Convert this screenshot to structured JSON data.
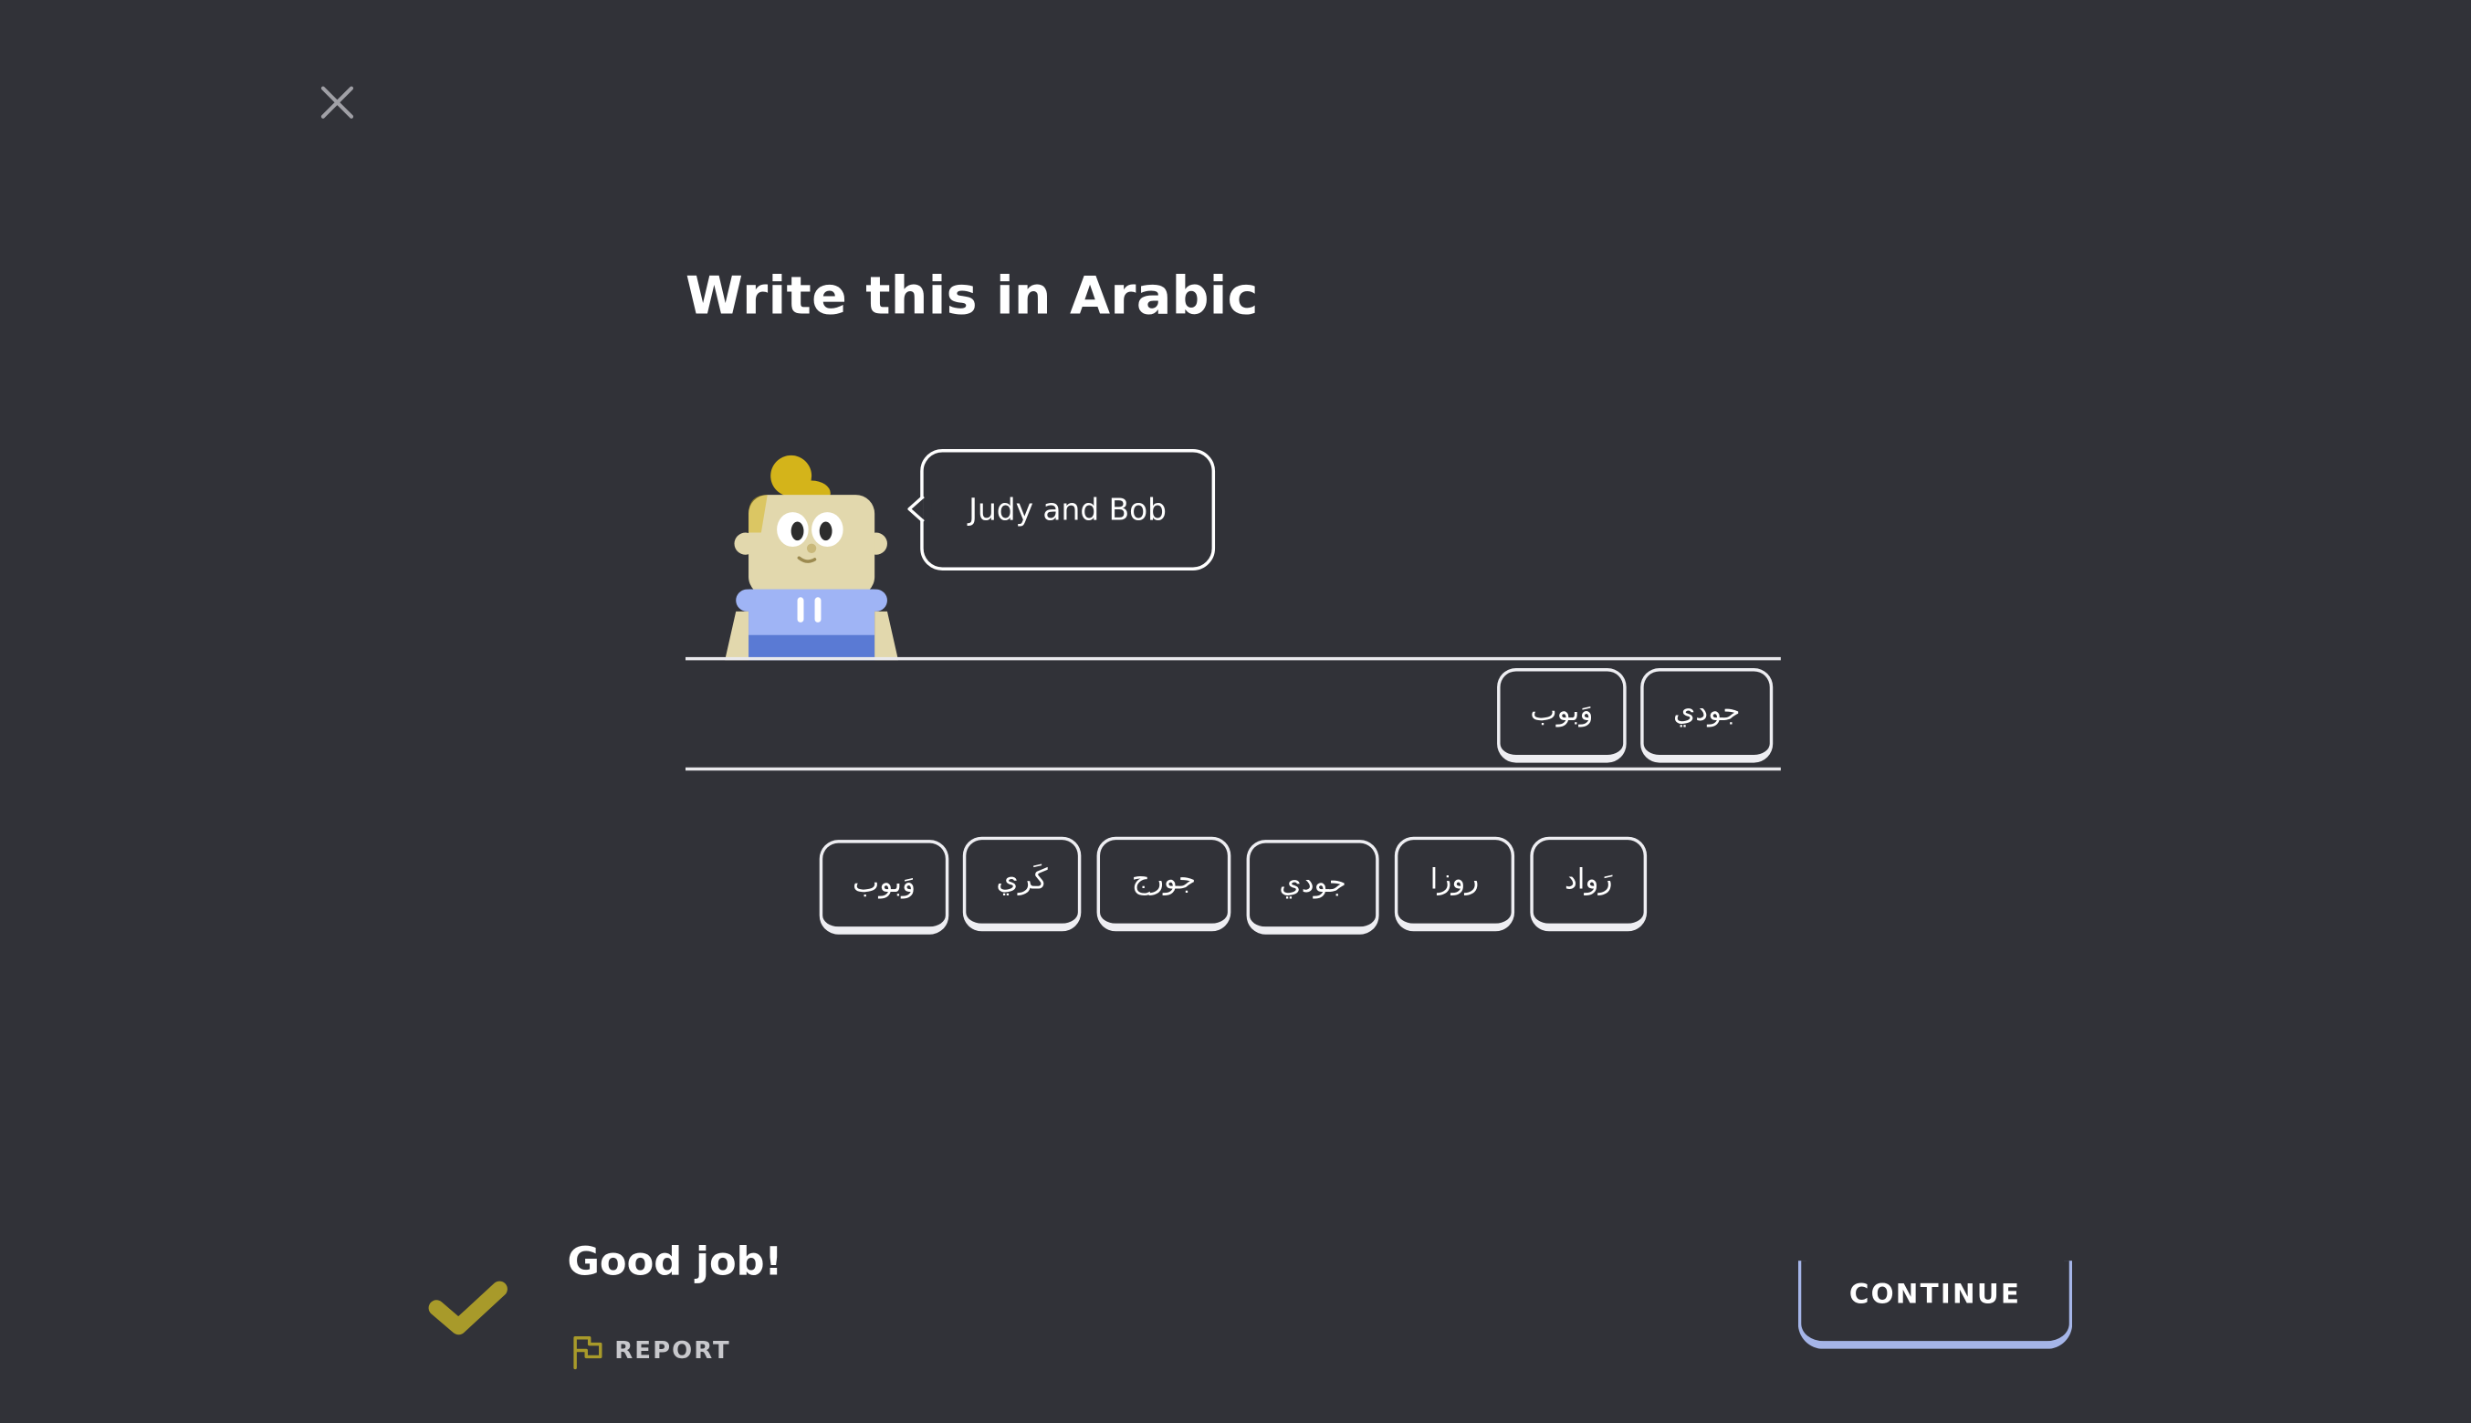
{
  "exercise": {
    "prompt_title": "Write this in Arabic",
    "speech_bubble": "Judy and Bob"
  },
  "answer_tiles": [
    "جودي",
    "وَبوب"
  ],
  "word_bank": [
    "وَبوب",
    "كَري",
    "جورج",
    "جودي",
    "روزا",
    "رَواد"
  ],
  "feedback": {
    "status": "correct",
    "message": "Good job!",
    "report_label": "REPORT",
    "continue_label": "CONTINUE"
  },
  "colors": {
    "background": "#313238",
    "tile_border": "#eeeef2",
    "check_accent": "#a89a2a",
    "continue_accent": "#a5b5e8"
  },
  "icons": {
    "close": "close-icon",
    "check": "checkmark-icon",
    "report": "flag-icon"
  }
}
